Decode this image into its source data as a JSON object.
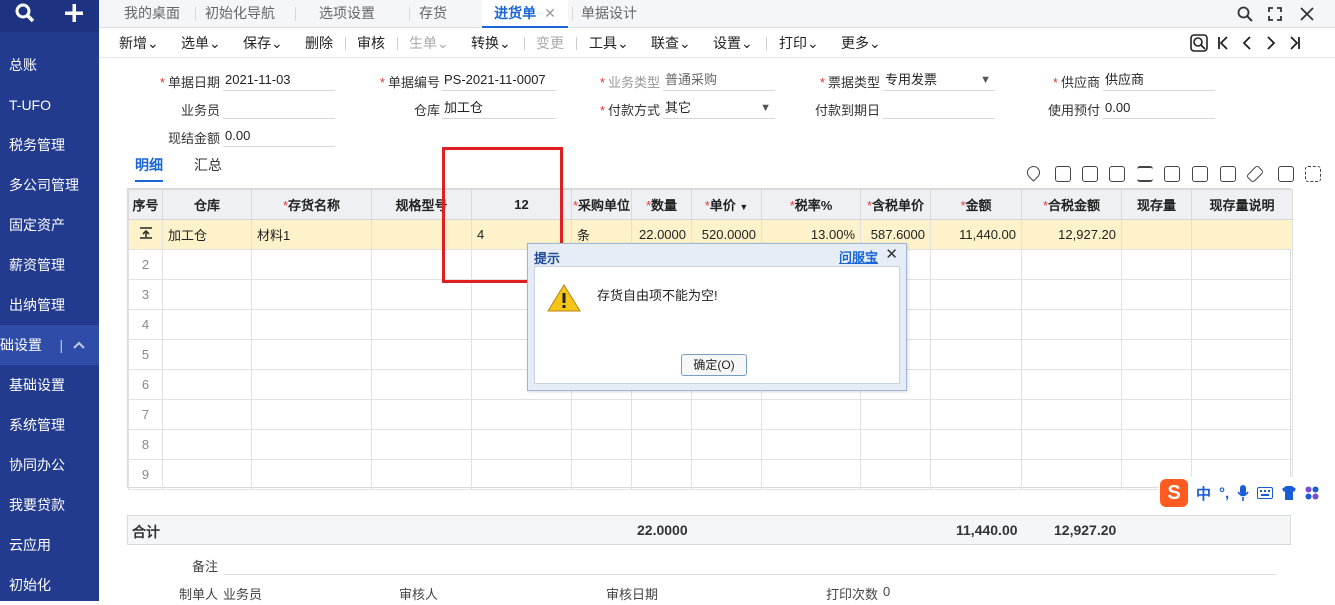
{
  "sidebar": {
    "items": [
      "总账",
      "T-UFO",
      "税务管理",
      "多公司管理",
      "固定资产",
      "薪资管理",
      "出纳管理"
    ],
    "section": "础设置",
    "section_sep": "|",
    "subitems": [
      "基础设置",
      "系统管理",
      "协同办公",
      "我要贷款",
      "云应用",
      "初始化"
    ]
  },
  "tabs": {
    "items": [
      {
        "label": "我的桌面"
      },
      {
        "label": "初始化导航"
      },
      {
        "label": "选项设置"
      },
      {
        "label": "存货"
      },
      {
        "label": "进货单"
      },
      {
        "label": "单据设计"
      }
    ],
    "close_glyph": "✕"
  },
  "toolbar": {
    "items": [
      "新增",
      "选单",
      "保存",
      "删除",
      "审核",
      "生单",
      "转换",
      "变更",
      "工具",
      "联查",
      "设置",
      "打印",
      "更多"
    ],
    "arrow": "⌄"
  },
  "form": {
    "date_label": "单据日期",
    "date_value": "2021-11-03",
    "no_label": "单据编号",
    "no_value": "PS-2021-11-0007",
    "biztype_label": "业务类型",
    "biztype_value": "普通采购",
    "invtype_label": "票据类型",
    "invtype_value": "专用发票",
    "supplier_label": "供应商",
    "supplier_value": "供应商",
    "clerk_label": "业务员",
    "clerk_value": "",
    "warehouse_label": "仓库",
    "warehouse_value": "加工仓",
    "paymethod_label": "付款方式",
    "paymethod_value": "其它",
    "paydue_label": "付款到期日",
    "paydue_value": "",
    "prepay_label": "使用预付",
    "prepay_value": "0.00",
    "cash_label": "现结金额",
    "cash_value": "0.00"
  },
  "subtabs": [
    "明细",
    "汇总"
  ],
  "grid": {
    "headers": [
      "序号",
      "仓库",
      "存货名称",
      "规格型号",
      "12",
      "采购单位",
      "数量",
      "单价",
      "税率%",
      "含税单价",
      "金额",
      "合税金额",
      "现存量",
      "现存量说明"
    ],
    "row1": {
      "wh": "加工仓",
      "name": "材料1",
      "spec": "",
      "free": "4",
      "unit": "条",
      "qty": "22.0000",
      "price": "520.0000",
      "tax": "13.00%",
      "taxprice": "587.6000",
      "amount": "11,440.00",
      "taxamount": "12,927.20"
    },
    "row_numbers": [
      "2",
      "3",
      "4",
      "5",
      "6",
      "7",
      "8",
      "9"
    ]
  },
  "summary": {
    "label": "合计",
    "qty": "22.0000",
    "amount": "11,440.00",
    "taxamount": "12,927.20"
  },
  "footer": {
    "remark_label": "备注",
    "maker_label": "制单人",
    "maker_value": "业务员",
    "auditor_label": "审核人",
    "audit_date_label": "审核日期",
    "print_count_label": "打印次数",
    "print_count_value": "0"
  },
  "dialog": {
    "title": "提示",
    "help_link": "问服宝",
    "message": "存货自由项不能为空!",
    "ok_label": "确定(O)"
  },
  "ime": {
    "logo": "S",
    "lang": "中",
    "punct": "°,"
  }
}
